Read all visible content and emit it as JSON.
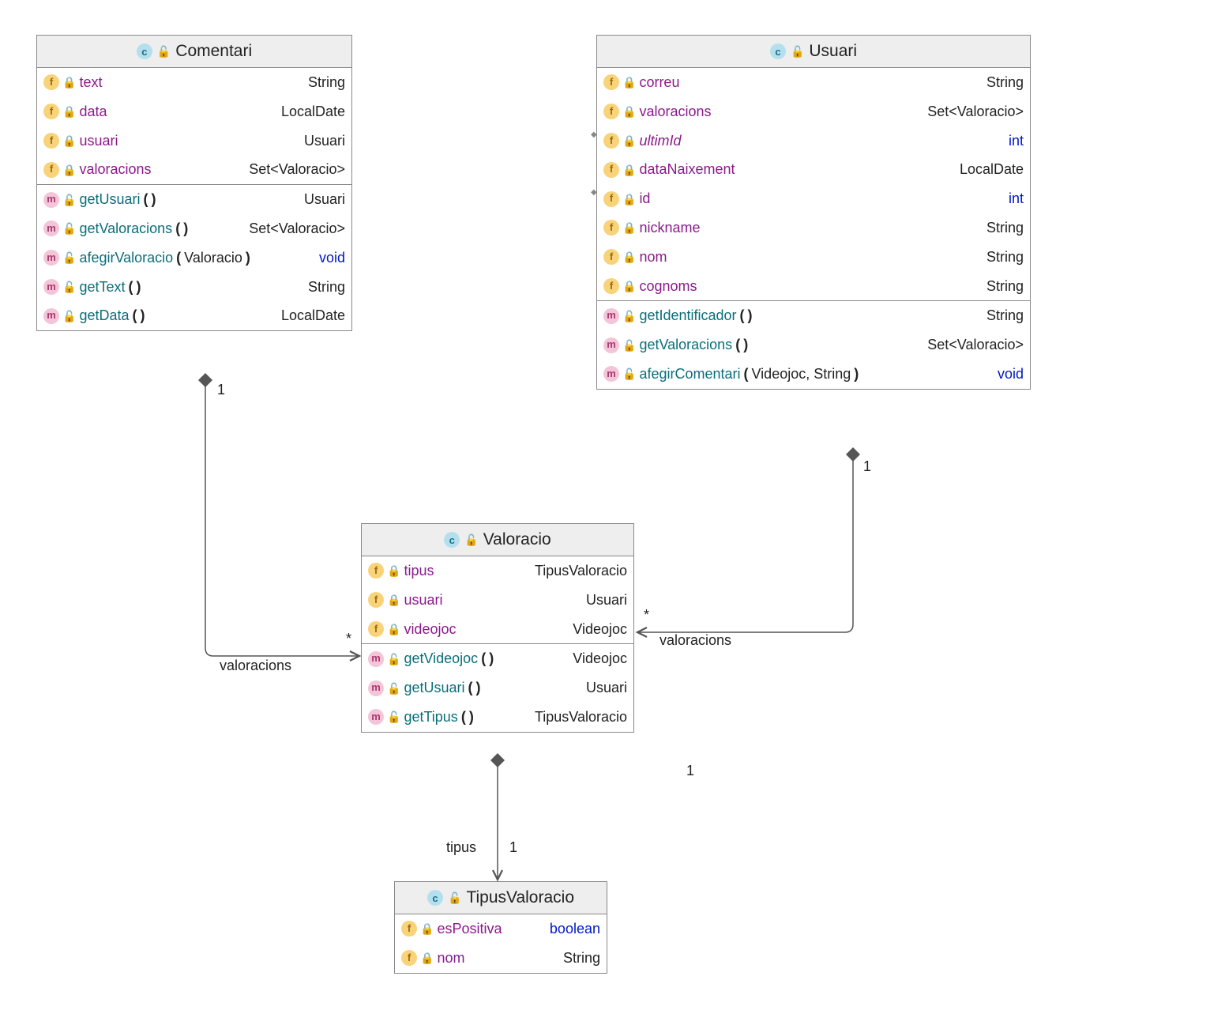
{
  "classes": {
    "comentari": {
      "name": "Comentari",
      "fields": [
        {
          "name": "text",
          "type": "String"
        },
        {
          "name": "data",
          "type": "LocalDate"
        },
        {
          "name": "usuari",
          "type": "Usuari"
        },
        {
          "name": "valoracions",
          "type": "Set<Valoracio>"
        }
      ],
      "methods": [
        {
          "name": "getUsuari",
          "params": "",
          "ret": "Usuari"
        },
        {
          "name": "getValoracions",
          "params": "",
          "ret": "Set<Valoracio>"
        },
        {
          "name": "afegirValoracio",
          "params": "Valoracio",
          "ret": "void",
          "retKeyword": true
        },
        {
          "name": "getText",
          "params": "",
          "ret": "String"
        },
        {
          "name": "getData",
          "params": "",
          "ret": "LocalDate"
        }
      ]
    },
    "usuari": {
      "name": "Usuari",
      "fields": [
        {
          "name": "correu",
          "type": "String"
        },
        {
          "name": "valoracions",
          "type": "Set<Valoracio>"
        },
        {
          "name": "ultimId",
          "type": "int",
          "typeKeyword": true,
          "italic": true,
          "pin": true
        },
        {
          "name": "dataNaixement",
          "type": "LocalDate"
        },
        {
          "name": "id",
          "type": "int",
          "typeKeyword": true,
          "pin": true
        },
        {
          "name": "nickname",
          "type": "String"
        },
        {
          "name": "nom",
          "type": "String"
        },
        {
          "name": "cognoms",
          "type": "String"
        }
      ],
      "methods": [
        {
          "name": "getIdentificador",
          "params": "",
          "ret": "String"
        },
        {
          "name": "getValoracions",
          "params": "",
          "ret": "Set<Valoracio>"
        },
        {
          "name": "afegirComentari",
          "params": "Videojoc, String",
          "ret": "void",
          "retKeyword": true
        }
      ]
    },
    "valoracio": {
      "name": "Valoracio",
      "fields": [
        {
          "name": "tipus",
          "type": "TipusValoracio"
        },
        {
          "name": "usuari",
          "type": "Usuari"
        },
        {
          "name": "videojoc",
          "type": "Videojoc"
        }
      ],
      "methods": [
        {
          "name": "getVideojoc",
          "params": "",
          "ret": "Videojoc"
        },
        {
          "name": "getUsuari",
          "params": "",
          "ret": "Usuari"
        },
        {
          "name": "getTipus",
          "params": "",
          "ret": "TipusValoracio"
        }
      ]
    },
    "tipusValoracio": {
      "name": "TipusValoracio",
      "fields": [
        {
          "name": "esPositiva",
          "type": "boolean",
          "typeKeyword": true
        },
        {
          "name": "nom",
          "type": "String"
        }
      ]
    }
  },
  "labels": {
    "one": "1",
    "many": "*",
    "valoracions": "valoracions",
    "tipus": "tipus"
  },
  "icons": {
    "c": "c",
    "f": "f",
    "m": "m"
  }
}
